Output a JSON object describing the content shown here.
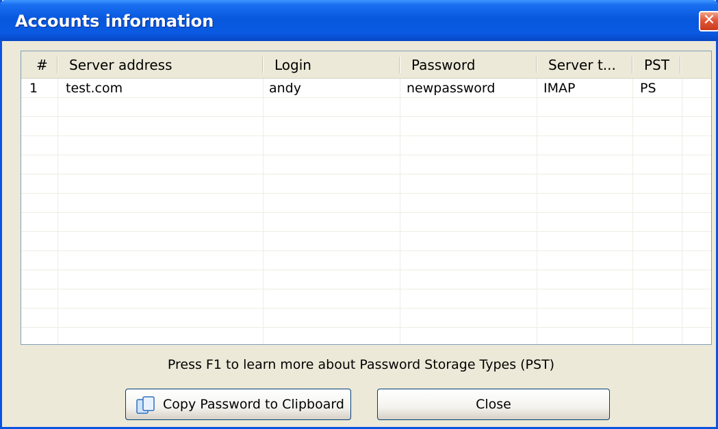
{
  "window": {
    "title": "Accounts information",
    "close_glyph": "✕"
  },
  "table": {
    "columns": [
      "#",
      "Server address",
      "Login",
      "Password",
      "Server t...",
      "PST"
    ],
    "rows": [
      {
        "num": "1",
        "server": "test.com",
        "login": "andy",
        "password": "newpassword",
        "server_type": "IMAP",
        "pst": "PS"
      }
    ]
  },
  "hint": "Press F1 to learn more about Password Storage Types (PST)",
  "buttons": {
    "copy": {
      "label": "Copy Password to Clipboard",
      "icon": "copy-icon"
    },
    "close": {
      "label": "Close"
    }
  },
  "colors": {
    "titlebar": "#0858de",
    "window_bg": "#ece9d8",
    "close_button": "#e2573a"
  }
}
